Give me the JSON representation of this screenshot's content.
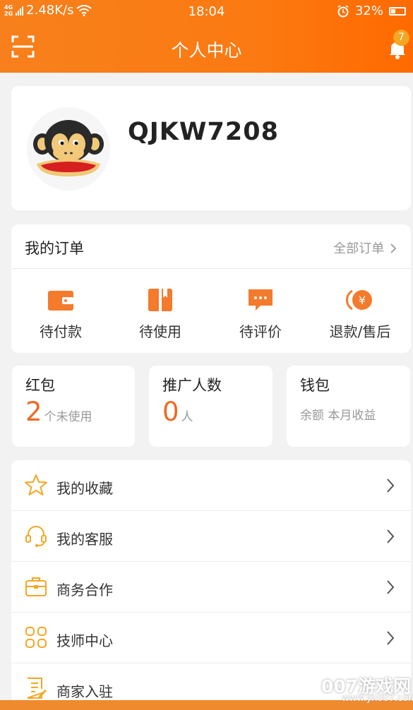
{
  "status_bar": {
    "network": "4G 2G",
    "speed": "2.48K/s",
    "time": "18:04",
    "battery": "32%"
  },
  "header": {
    "title": "个人中心",
    "notification_count": "7",
    "scan_icon": "scan-icon",
    "bell_icon": "bell-icon"
  },
  "profile": {
    "username": "QJKW7208"
  },
  "orders": {
    "title": "我的订单",
    "all_label": "全部订单",
    "items": [
      {
        "label": "待付款",
        "icon": "wallet-icon"
      },
      {
        "label": "待使用",
        "icon": "book-icon"
      },
      {
        "label": "待评价",
        "icon": "comment-icon"
      },
      {
        "label": "退款/售后",
        "icon": "refund-icon"
      }
    ]
  },
  "stats": {
    "red_packet": {
      "title": "红包",
      "value": "2",
      "unit": "个未使用"
    },
    "promotion": {
      "title": "推广人数",
      "value": "0",
      "unit": "人"
    },
    "wallet": {
      "title": "钱包",
      "sub": "余额 本月收益"
    }
  },
  "menu": [
    {
      "label": "我的收藏",
      "icon": "star-icon"
    },
    {
      "label": "我的客服",
      "icon": "headset-icon"
    },
    {
      "label": "商务合作",
      "icon": "briefcase-icon"
    },
    {
      "label": "技师中心",
      "icon": "grid-icon"
    },
    {
      "label": "商家入驻",
      "icon": "document-icon"
    }
  ],
  "watermark": {
    "main": "007游戏网",
    "url": "www.yx007.com"
  },
  "colors": {
    "brand_orange": "#fb7a12",
    "accent_number": "#f06a22",
    "icon_orange": "#f5a623"
  }
}
